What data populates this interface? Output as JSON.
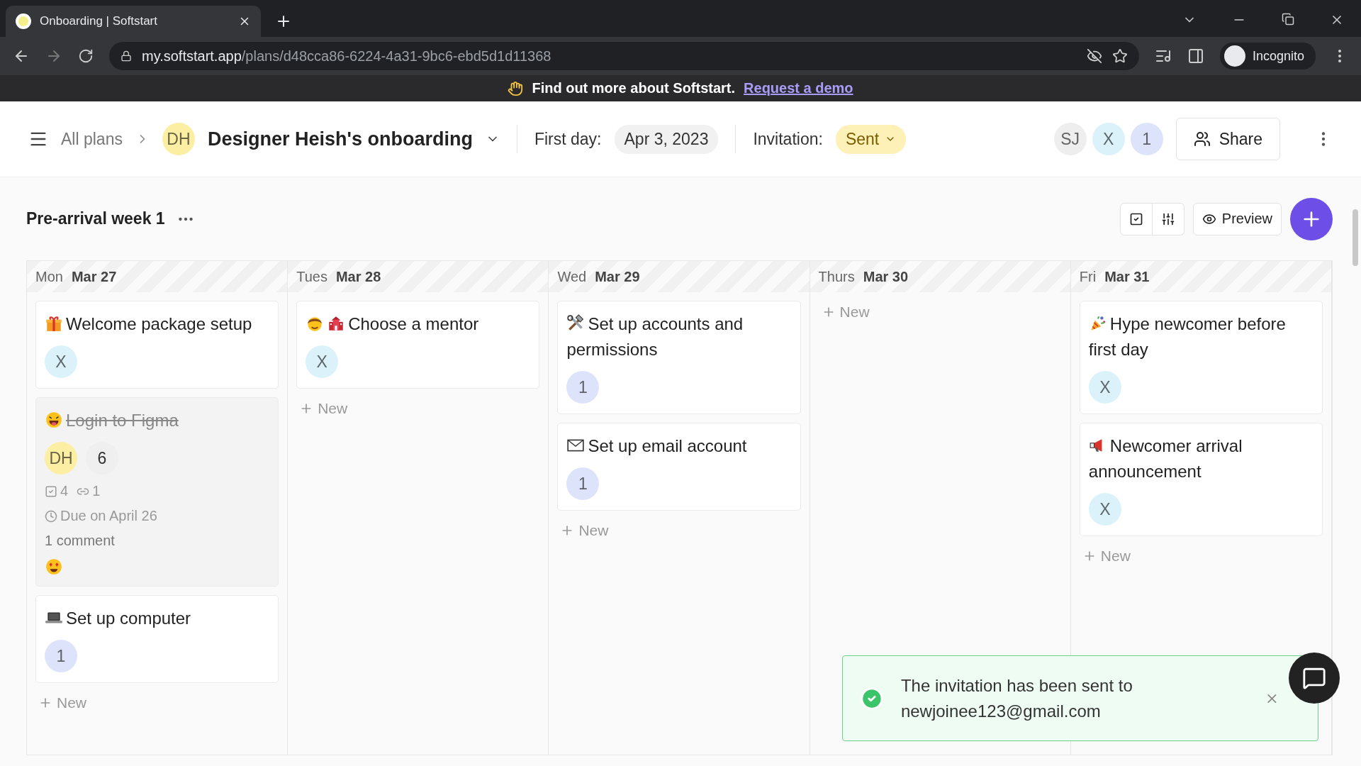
{
  "browser": {
    "tab_title": "Onboarding | Softstart",
    "url_host": "my.softstart.app",
    "url_path": "/plans/d48cca86-6224-4a31-9bc6-ebd5d1d11368",
    "profile": "Incognito"
  },
  "banner": {
    "text": "Find out more about Softstart.",
    "link": "Request a demo"
  },
  "header": {
    "breadcrumb": "All plans",
    "plan_avatar": {
      "initials": "DH",
      "color": "#fcefa3"
    },
    "title": "Designer Heish's onboarding",
    "first_day_label": "First day:",
    "first_day": "Apr 3, 2023",
    "invitation_label": "Invitation:",
    "invitation": "Sent",
    "members": [
      {
        "initials": "SJ",
        "color": "#eeeeee"
      },
      {
        "initials": "X",
        "color": "#dcf2fb"
      },
      {
        "initials": "1",
        "color": "#dde3fb"
      }
    ],
    "share": "Share"
  },
  "section": {
    "title": "Pre-arrival week 1",
    "preview": "Preview"
  },
  "columns": [
    {
      "day": "Mon",
      "date": "Mar 27",
      "new_label": "New",
      "tasks": [
        {
          "kind": "gift",
          "title": "Welcome package setup",
          "done": false,
          "assignees": [
            {
              "initials": "X",
              "color": "#dcf2fb"
            }
          ]
        },
        {
          "kind": "tongue",
          "title": "Login to Figma",
          "done": true,
          "assignees": [
            {
              "initials": "DH",
              "color": "#fcefa3"
            }
          ],
          "count": "6",
          "checklist": "4",
          "links": "1",
          "due": "Due on April 26",
          "comments": "1 comment",
          "reactions": [
            {
              "kind": "hearteyes"
            }
          ]
        },
        {
          "kind": "laptop",
          "title": "Set up computer",
          "done": false,
          "assignees": [
            {
              "initials": "1",
              "color": "#dde3fb"
            }
          ]
        }
      ]
    },
    {
      "day": "Tues",
      "date": "Mar 28",
      "new_label": "New",
      "tasks": [
        {
          "kind": "mentor",
          "title": "Choose a mentor",
          "done": false,
          "assignees": [
            {
              "initials": "X",
              "color": "#dcf2fb"
            }
          ]
        }
      ]
    },
    {
      "day": "Wed",
      "date": "Mar 29",
      "new_label": "New",
      "tasks": [
        {
          "kind": "tools",
          "title": "Set up accounts and permissions",
          "done": false,
          "assignees": [
            {
              "initials": "1",
              "color": "#dde3fb"
            }
          ]
        },
        {
          "kind": "envelope",
          "title": "Set up email account",
          "done": false,
          "assignees": [
            {
              "initials": "1",
              "color": "#dde3fb"
            }
          ]
        }
      ]
    },
    {
      "day": "Thurs",
      "date": "Mar 30",
      "new_label": "New"
    },
    {
      "day": "Fri",
      "date": "Mar 31",
      "new_label": "New",
      "tasks": [
        {
          "kind": "party",
          "title": "Hype newcomer before first day",
          "done": false,
          "assignees": [
            {
              "initials": "X",
              "color": "#dcf2fb"
            }
          ]
        },
        {
          "kind": "megaphone",
          "title": "Newcomer arrival announcement",
          "done": false,
          "assignees": [
            {
              "initials": "X",
              "color": "#dcf2fb"
            }
          ]
        }
      ]
    }
  ],
  "toast": {
    "message": "The invitation has been sent to newjoinee123@gmail.com"
  }
}
